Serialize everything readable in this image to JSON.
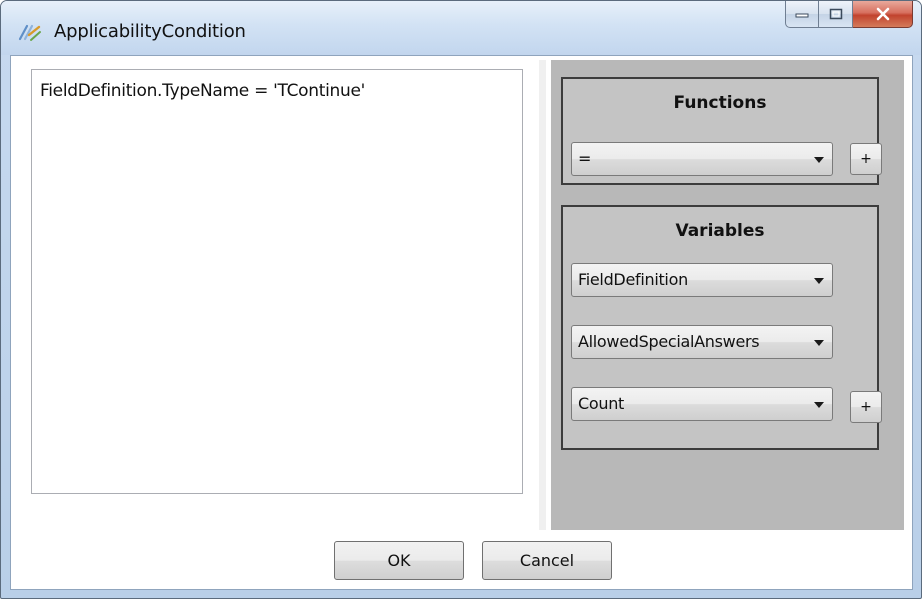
{
  "window": {
    "title": "ApplicabilityCondition",
    "icon": "formula-icon"
  },
  "editor": {
    "text": "FieldDefinition.TypeName = 'TContinue'"
  },
  "functions": {
    "title": "Functions",
    "selected": "=",
    "add_label": "+"
  },
  "variables": {
    "title": "Variables",
    "combo1": "FieldDefinition",
    "combo2": "AllowedSpecialAnswers",
    "combo3": "Count",
    "add_label": "+"
  },
  "buttons": {
    "ok": "OK",
    "cancel": "Cancel"
  },
  "colors": {
    "close_button": "#c1432e",
    "panel_bg": "#b8b8b8",
    "group_border": "#3c3c3c"
  }
}
